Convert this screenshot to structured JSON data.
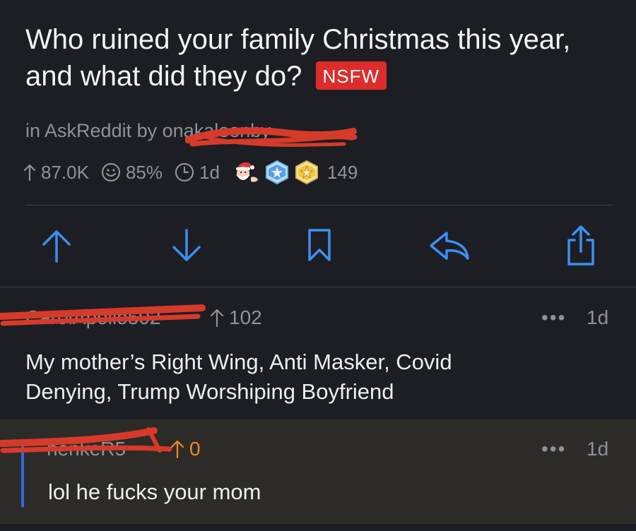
{
  "post": {
    "title": "Who ruined your family Christmas this year, and what did they do?",
    "nsfw_label": "NSFW",
    "in_label": "in",
    "subreddit": "AskReddit",
    "by_label": "by",
    "author": "onakaleenby",
    "upvotes": "87.0K",
    "upvote_ratio": "85%",
    "age": "1d",
    "awards": [
      "santa-award-icon",
      "snowflake-award-icon",
      "star-award-icon"
    ],
    "comment_count": "149"
  },
  "actions": [
    "upvote-icon",
    "downvote-icon",
    "bookmark-icon",
    "reply-icon",
    "share-icon"
  ],
  "comments": [
    {
      "author": "CarolApollo502",
      "score": "102",
      "time": "1d",
      "more": "•••",
      "body_line1": "My mother’s Right Wing, Anti Masker, Covid",
      "body_line2": "Denying, Trump Worshiping Boyfriend",
      "score_color": "#8e929a"
    },
    {
      "author": "henkeR5",
      "score": "0",
      "time": "1d",
      "more": "•••",
      "body": "lol he fucks your mom",
      "score_color": "#f08a24"
    }
  ],
  "colors": {
    "accent": "#3d8ff2",
    "redaction": "#d63a2a",
    "nsfw": "#dd2c2c",
    "background": "#1c1e24",
    "reply_background": "#2c2b28",
    "thread_line": "#2d6cdf"
  }
}
